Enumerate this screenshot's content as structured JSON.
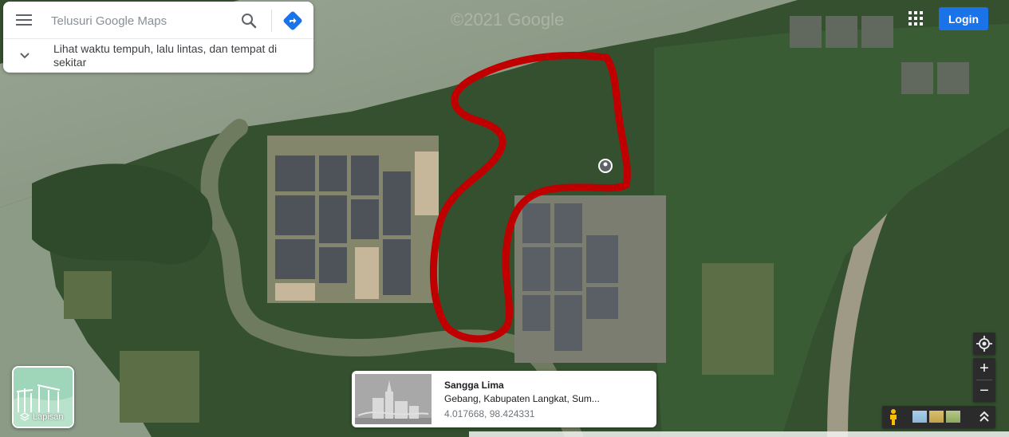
{
  "map": {
    "watermark": "©2021 Google"
  },
  "search": {
    "placeholder": "Telusuri Google Maps",
    "expand_text": "Lihat waktu tempuh, lalu lintas, dan tempat di sekitar",
    "icons": {
      "menu": "hamburger-menu-icon",
      "search": "search-icon",
      "directions": "directions-icon",
      "expand": "chevron-down-icon"
    }
  },
  "header": {
    "apps_icon": "apps-grid-icon",
    "login_label": "Login",
    "login_color": "#1a73e8"
  },
  "layers": {
    "label": "Lapisan",
    "icon": "layers-icon"
  },
  "place": {
    "name": "Sangga Lima",
    "address": "Gebang, Kabupaten Langkat, Sum...",
    "coordinates": "4.017668, 98.424331"
  },
  "controls": {
    "my_location_icon": "my-location-icon",
    "zoom_in_label": "+",
    "zoom_out_label": "−",
    "pegman_icon": "pegman-icon",
    "collapse_icon": "double-chevron-up-icon"
  },
  "route": {
    "color": "#c00000"
  }
}
